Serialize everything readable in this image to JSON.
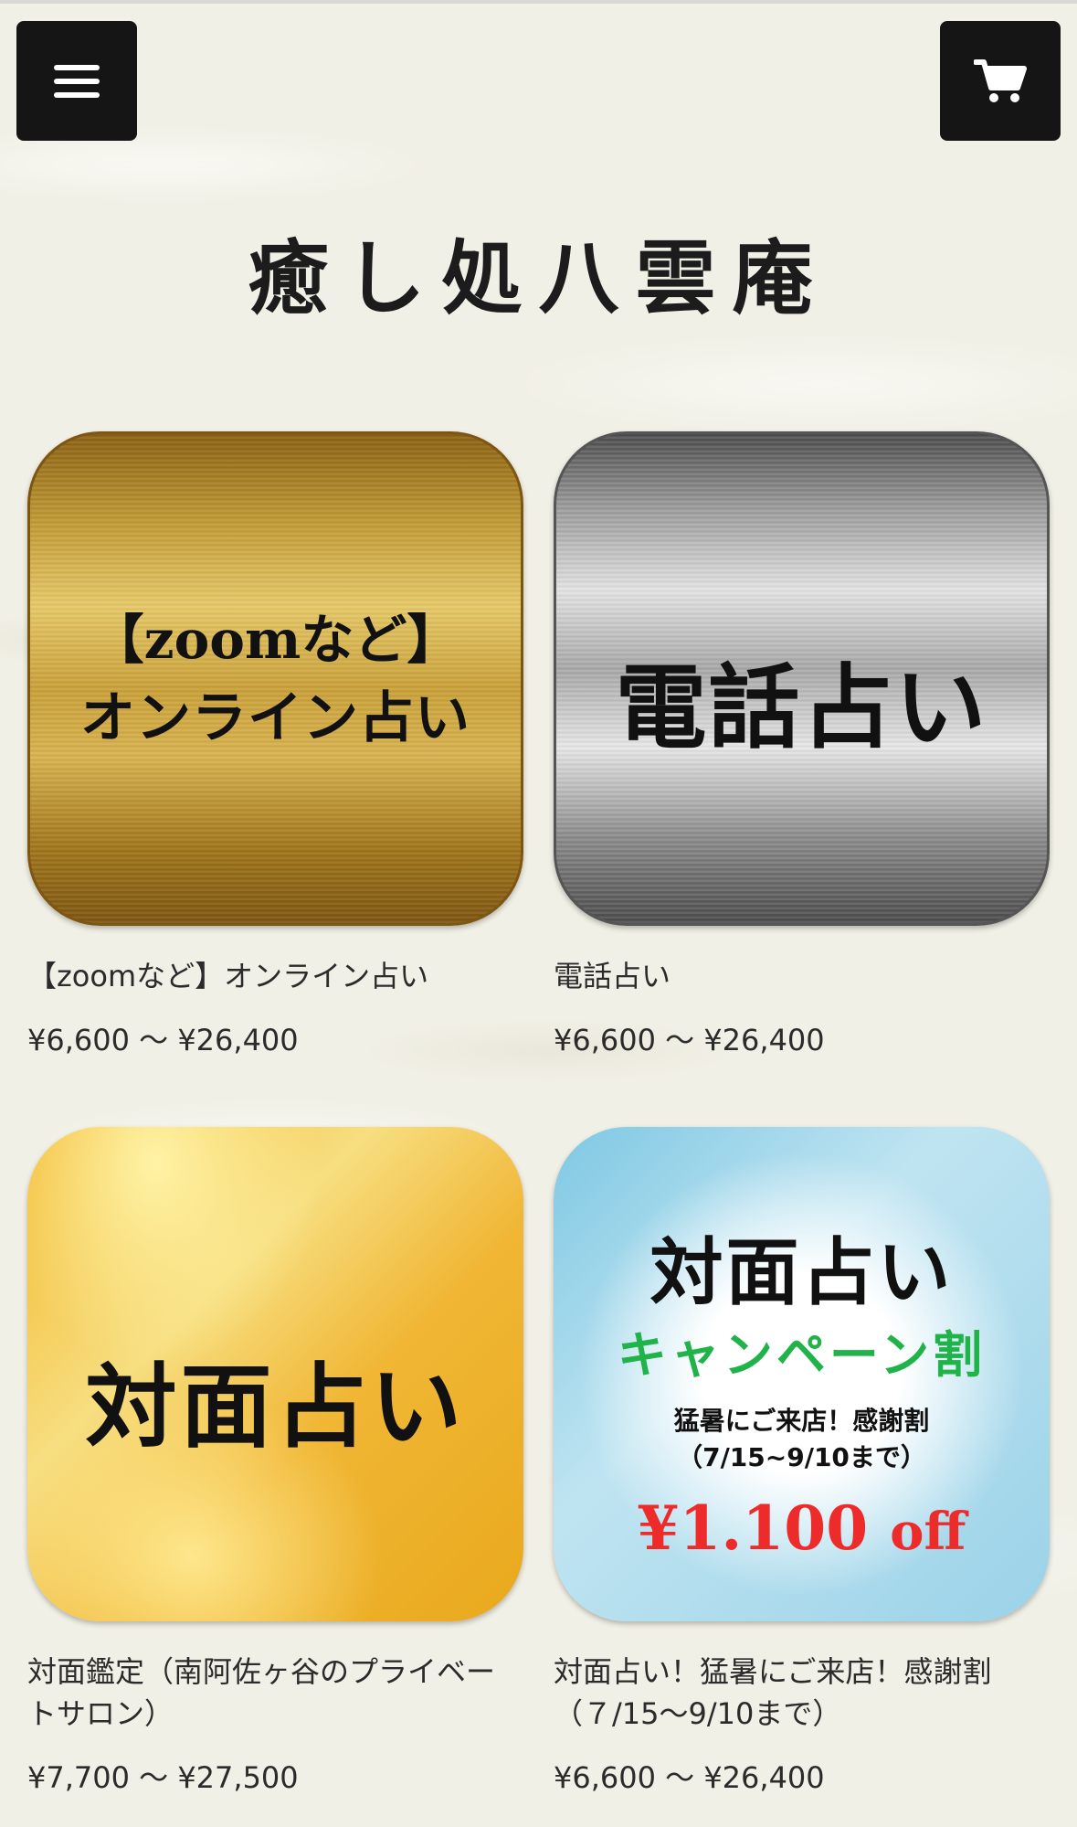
{
  "header": {
    "menu_icon": "hamburger-menu-icon",
    "cart_icon": "shopping-cart-icon",
    "site_title": "癒し処八雲庵"
  },
  "products": [
    {
      "thumb_lines": [
        "【zoomなど】",
        "オンライン占い"
      ],
      "name": "【zoomなど】オンライン占い",
      "price": "¥6,600 〜 ¥26,400"
    },
    {
      "thumb_lines": [
        "電話占い"
      ],
      "name": "電話占い",
      "price": "¥6,600 〜 ¥26,400"
    },
    {
      "thumb_lines": [
        "対面占い"
      ],
      "name": "対面鑑定（南阿佐ヶ谷のプライベートサロン）",
      "price": "¥7,700 〜 ¥27,500"
    },
    {
      "thumb_lines": [
        "対面占い",
        "キャンペーン割",
        "猛暑にご来店！感謝割",
        "（7/15~9/10まで）",
        "¥1.100",
        "off"
      ],
      "name": "対面占い！猛暑にご来店！感謝割（７/15〜9/10まで）",
      "price": "¥6,600 〜 ¥26,400"
    }
  ],
  "colors": {
    "button_bg": "#151515",
    "campaign_green": "#1fb34a",
    "campaign_red": "#ee2b2b"
  }
}
